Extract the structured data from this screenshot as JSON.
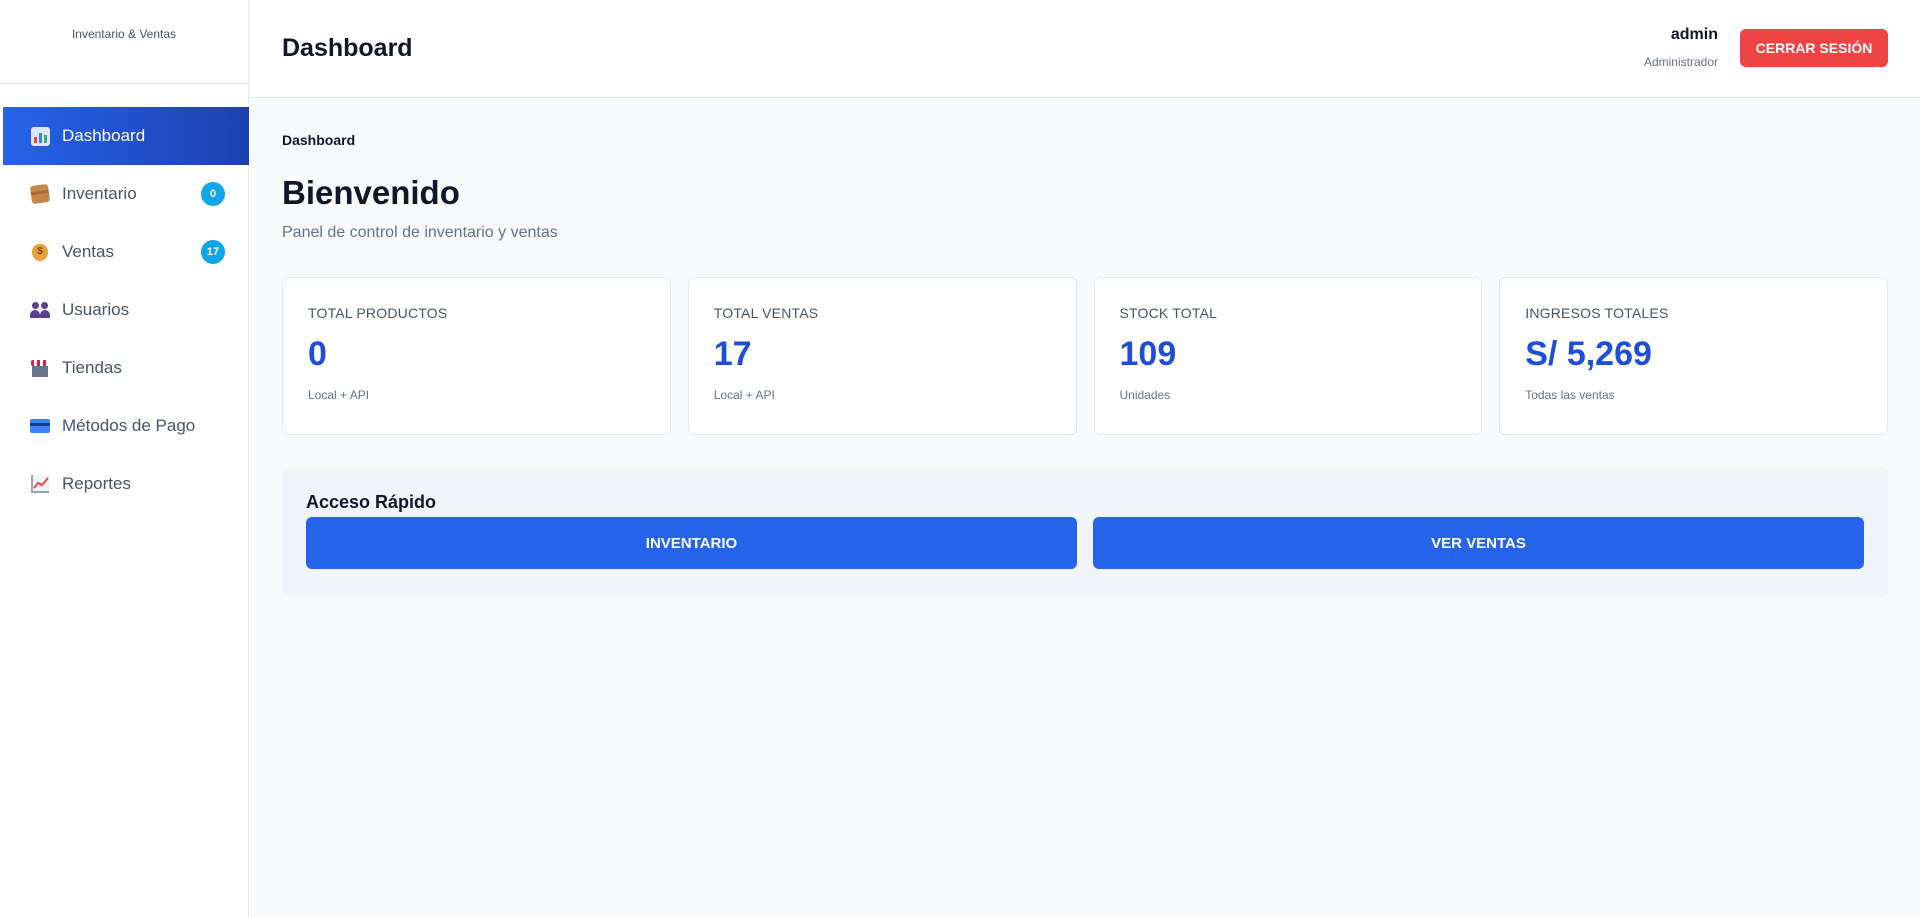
{
  "brand": {
    "name": "Inventario & Ventas"
  },
  "sidebar": {
    "items": [
      {
        "label": "Dashboard",
        "icon": "bar-chart-icon",
        "active": true,
        "badge": ""
      },
      {
        "label": "Inventario",
        "icon": "package-icon",
        "active": false,
        "badge": "0"
      },
      {
        "label": "Ventas",
        "icon": "money-bag-icon",
        "active": false,
        "badge": "17"
      },
      {
        "label": "Usuarios",
        "icon": "users-icon",
        "active": false,
        "badge": ""
      },
      {
        "label": "Tiendas",
        "icon": "store-icon",
        "active": false,
        "badge": ""
      },
      {
        "label": "Métodos de Pago",
        "icon": "credit-card-icon",
        "active": false,
        "badge": ""
      },
      {
        "label": "Reportes",
        "icon": "trend-chart-icon",
        "active": false,
        "badge": ""
      }
    ]
  },
  "header": {
    "title": "Dashboard",
    "user_name": "admin",
    "user_role": "Administrador",
    "logout_label": "CERRAR SESIÓN"
  },
  "main": {
    "breadcrumb": "Dashboard",
    "welcome": "Bienvenido",
    "subtitle": "Panel de control de inventario y ventas",
    "stats": [
      {
        "label": "TOTAL PRODUCTOS",
        "value": "0",
        "sub": "Local + API"
      },
      {
        "label": "TOTAL VENTAS",
        "value": "17",
        "sub": "Local + API"
      },
      {
        "label": "STOCK TOTAL",
        "value": "109",
        "sub": "Unidades"
      },
      {
        "label": "INGRESOS TOTALES",
        "value": "S/ 5,269",
        "sub": "Todas las ventas"
      }
    ],
    "quick_access": {
      "title": "Acceso Rápido",
      "buttons": [
        "INVENTARIO",
        "VER VENTAS"
      ]
    }
  },
  "colors": {
    "primary": "#2563eb",
    "active_gradient_end": "#1e40af",
    "danger": "#ef4444",
    "badge": "#0ea5e9",
    "stat_value": "#1d4ed8"
  }
}
